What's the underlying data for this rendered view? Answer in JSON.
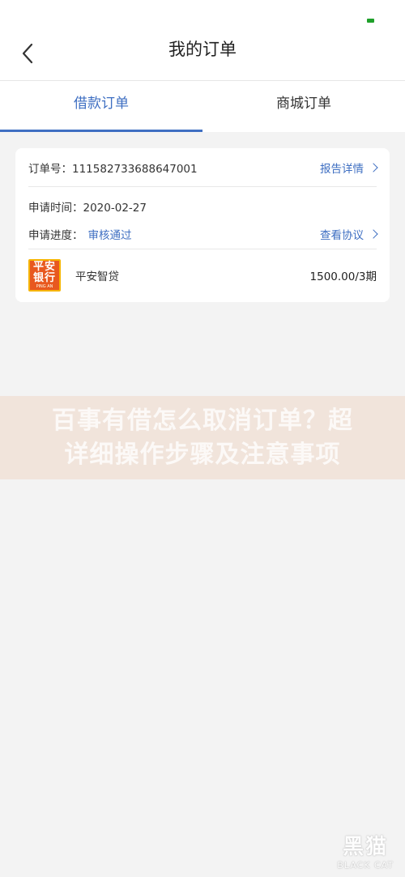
{
  "header": {
    "title": "我的订单"
  },
  "tabs": [
    {
      "label": "借款订单",
      "active": true
    },
    {
      "label": "商城订单",
      "active": false
    }
  ],
  "order": {
    "order_no_label": "订单号：",
    "order_no": "111582733688647001",
    "report_link": "报告详情",
    "apply_time_label": "申请时间：",
    "apply_time": "2020-02-27",
    "progress_label": "申请进度：",
    "progress_status": "审核通过",
    "agreement_link": "查看协议",
    "product": {
      "logo_line1": "平安",
      "logo_line2": "银行",
      "logo_sub": "PING AN",
      "name": "平安智贷",
      "amount": "1500.00/3期"
    }
  },
  "watermark": {
    "line1": "百事有借怎么取消订单？超",
    "line2": "详细操作步骤及注意事项"
  },
  "corner_brand": {
    "cn": "黑猫",
    "en": "BLACK CAT"
  },
  "colors": {
    "accent": "#3f6fc2",
    "logo_bg": "#e8581f"
  }
}
